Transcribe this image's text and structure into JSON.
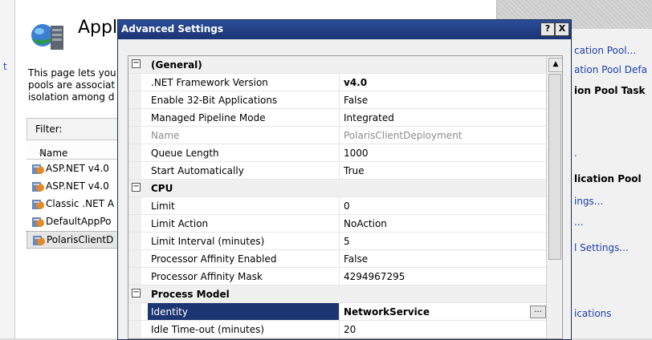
{
  "left_strip": {
    "char": "t"
  },
  "background": {
    "title": "Appli",
    "description": [
      "This page lets you",
      "pools are associat",
      "isolation among d"
    ],
    "filter_label": "Filter:",
    "list_header": "Name",
    "pools": [
      "ASP.NET v4.0",
      "ASP.NET v4.0",
      "Classic .NET A",
      "DefaultAppPo",
      "PolarisClientD"
    ]
  },
  "actions": {
    "items": [
      {
        "text": "cation Pool...",
        "style": "normal"
      },
      {
        "text": "ation Pool Defa",
        "style": "normal"
      },
      {
        "text": "ion Pool Task",
        "style": "bold"
      },
      {
        "text": ".",
        "style": "normal"
      },
      {
        "text": "lication Pool",
        "style": "bold"
      },
      {
        "text": "ings...",
        "style": "link"
      },
      {
        "text": "...",
        "style": "link"
      },
      {
        "text": "l Settings...",
        "style": "link"
      },
      {
        "text": "ications",
        "style": "link"
      }
    ]
  },
  "dialog": {
    "title": "Advanced Settings",
    "help_button": "?",
    "close_button": "X",
    "categories": [
      {
        "name": "(General)",
        "expand": "⊟",
        "rows": [
          {
            "key": ".NET Framework Version",
            "value": "v4.0",
            "value_bold": true
          },
          {
            "key": "Enable 32-Bit Applications",
            "value": "False"
          },
          {
            "key": "Managed Pipeline Mode",
            "value": "Integrated"
          },
          {
            "key": "Name",
            "value": "PolarisClientDeployment",
            "disabled": true
          },
          {
            "key": "Queue Length",
            "value": "1000"
          },
          {
            "key": "Start Automatically",
            "value": "True"
          }
        ]
      },
      {
        "name": "CPU",
        "expand": "⊟",
        "rows": [
          {
            "key": "Limit",
            "value": "0"
          },
          {
            "key": "Limit Action",
            "value": "NoAction"
          },
          {
            "key": "Limit Interval (minutes)",
            "value": "5"
          },
          {
            "key": "Processor Affinity Enabled",
            "value": "False"
          },
          {
            "key": "Processor Affinity Mask",
            "value": "4294967295"
          }
        ]
      },
      {
        "name": "Process Model",
        "expand": "⊟",
        "rows": [
          {
            "key": "Identity",
            "value": "NetworkService",
            "value_bold": true,
            "selected": true,
            "ellipsis": "..."
          },
          {
            "key": "Idle Time-out (minutes)",
            "value": "20"
          }
        ]
      }
    ]
  },
  "colors": {
    "title_bar": "#1c3573",
    "selection": "#1c3573"
  }
}
